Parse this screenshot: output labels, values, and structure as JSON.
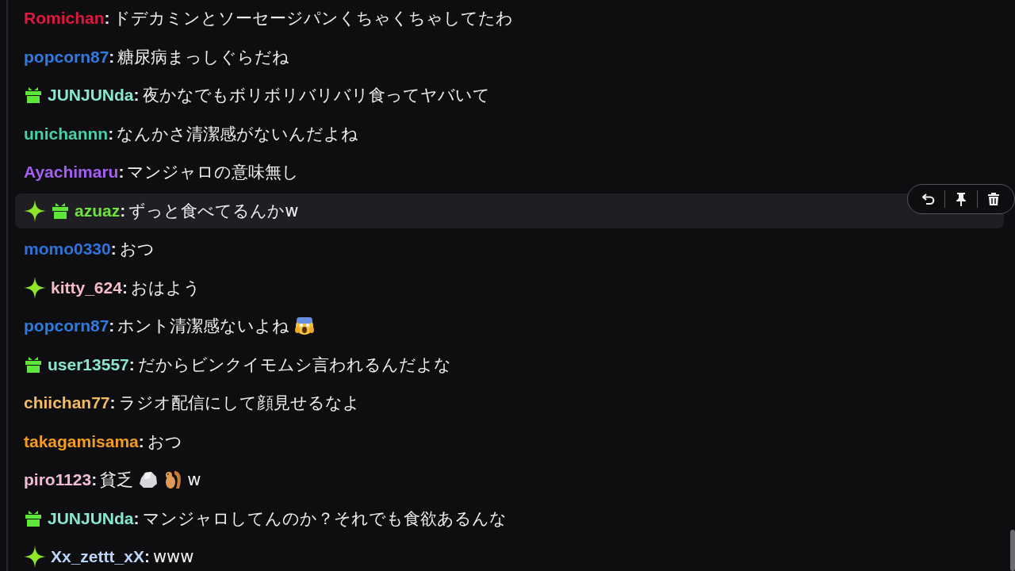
{
  "chat": {
    "messages": [
      {
        "user": "Romichan",
        "color": "#e0173f",
        "colon": ":",
        "parts": [
          {
            "kind": "text",
            "text": "ドデカミンとソーセージパンくちゃくちゃしてたわ"
          }
        ],
        "hovered": false
      },
      {
        "user": "popcorn87",
        "color": "#2f7be0",
        "colon": ":",
        "parts": [
          {
            "kind": "text",
            "text": "糖尿病まっしぐらだね"
          }
        ],
        "hovered": false
      },
      {
        "badges": [
          {
            "kind": "gift"
          }
        ],
        "user": "JUNJUNda",
        "color": "#8ae6cf",
        "colon": ":",
        "parts": [
          {
            "kind": "text",
            "text": "夜かなでもボリボリバリバリ食ってヤバいて"
          }
        ],
        "hovered": false
      },
      {
        "user": "unichannn",
        "color": "#44d2a6",
        "colon": ":",
        "parts": [
          {
            "kind": "text",
            "text": "なんかさ清潔感がないんだよね"
          }
        ],
        "hovered": false
      },
      {
        "user": "Ayachimaru",
        "color": "#a45ff2",
        "colon": ":",
        "parts": [
          {
            "kind": "text",
            "text": "マンジャロの意味無し"
          }
        ],
        "hovered": false
      },
      {
        "badges": [
          {
            "kind": "sparkle"
          },
          {
            "kind": "gift"
          }
        ],
        "user": "azuaz",
        "color": "#6ee33c",
        "colon": ":",
        "parts": [
          {
            "kind": "text",
            "text": "ずっと食べてるんかw"
          }
        ],
        "hovered": true
      },
      {
        "user": "momo0330",
        "color": "#2f72db",
        "colon": ":",
        "parts": [
          {
            "kind": "text",
            "text": "おつ"
          }
        ],
        "hovered": false
      },
      {
        "badges": [
          {
            "kind": "sparkle"
          }
        ],
        "user": "kitty_624",
        "color": "#f5bcc8",
        "colon": ":",
        "parts": [
          {
            "kind": "text",
            "text": "おはよう"
          }
        ],
        "hovered": false
      },
      {
        "user": "popcorn87",
        "color": "#2f7be0",
        "colon": ":",
        "parts": [
          {
            "kind": "text",
            "text": "ホント清潔感ないよね"
          },
          {
            "kind": "scream"
          }
        ],
        "hovered": false
      },
      {
        "badges": [
          {
            "kind": "gift"
          }
        ],
        "user": "user13557",
        "color": "#8ae6cf",
        "colon": ":",
        "parts": [
          {
            "kind": "text",
            "text": "だからビンクイモムシ言われるんだよな"
          }
        ],
        "hovered": false
      },
      {
        "user": "chiichan77",
        "color": "#f2bb63",
        "colon": ":",
        "parts": [
          {
            "kind": "text",
            "text": "ラジオ配信にして顔見せるなよ"
          }
        ],
        "hovered": false
      },
      {
        "user": "takagamisama",
        "color": "#f29c22",
        "colon": ":",
        "parts": [
          {
            "kind": "text",
            "text": "おつ"
          }
        ],
        "hovered": false
      },
      {
        "user": "piro1123",
        "color": "#f2bcd4",
        "colon": ":",
        "parts": [
          {
            "kind": "text",
            "text": "貧乏"
          },
          {
            "kind": "rock"
          },
          {
            "kind": "squirrel"
          },
          {
            "kind": "text",
            "text": "w"
          }
        ],
        "hovered": false
      },
      {
        "badges": [
          {
            "kind": "gift"
          }
        ],
        "user": "JUNJUNda",
        "color": "#8ae6cf",
        "colon": ":",
        "parts": [
          {
            "kind": "text",
            "text": "マンジャロしてんのか？それでも食欲あるんな"
          }
        ],
        "hovered": false
      },
      {
        "badges": [
          {
            "kind": "sparkle"
          }
        ],
        "user": "Xx_zettt_xX",
        "color": "#bcd3fa",
        "colon": ":",
        "parts": [
          {
            "kind": "text",
            "text": "www"
          }
        ],
        "hovered": false
      }
    ]
  }
}
